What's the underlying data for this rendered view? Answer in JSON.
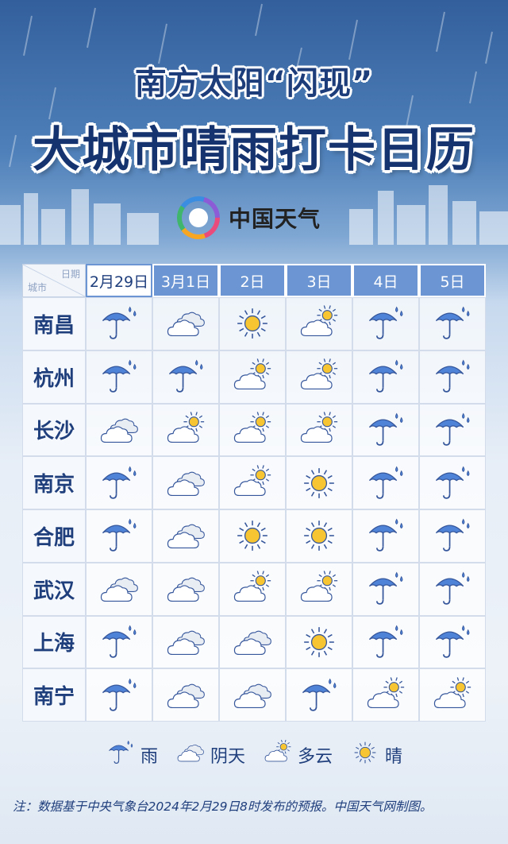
{
  "header": {
    "title_line1": "南方太阳“闪现”",
    "title_line2": "大城市晴雨打卡日历",
    "brand": "中国天气"
  },
  "table": {
    "corner_top": "日期",
    "corner_bottom": "城市",
    "dates": [
      "2月29日",
      "3月1日",
      "2日",
      "3日",
      "4日",
      "5日"
    ],
    "rows": [
      {
        "city": "南昌",
        "weather": [
          "rain",
          "overcast",
          "sunny",
          "cloudy",
          "rain",
          "rain"
        ]
      },
      {
        "city": "杭州",
        "weather": [
          "rain",
          "rain",
          "cloudy",
          "cloudy",
          "rain",
          "rain"
        ]
      },
      {
        "city": "长沙",
        "weather": [
          "overcast",
          "cloudy",
          "cloudy",
          "cloudy",
          "rain",
          "rain"
        ]
      },
      {
        "city": "南京",
        "weather": [
          "rain",
          "overcast",
          "cloudy",
          "sunny",
          "rain",
          "rain"
        ]
      },
      {
        "city": "合肥",
        "weather": [
          "rain",
          "overcast",
          "sunny",
          "sunny",
          "rain",
          "rain"
        ]
      },
      {
        "city": "武汉",
        "weather": [
          "overcast",
          "overcast",
          "cloudy",
          "cloudy",
          "rain",
          "rain"
        ]
      },
      {
        "city": "上海",
        "weather": [
          "rain",
          "overcast",
          "overcast",
          "sunny",
          "rain",
          "rain"
        ]
      },
      {
        "city": "南宁",
        "weather": [
          "rain",
          "overcast",
          "overcast",
          "rain",
          "cloudy",
          "cloudy"
        ]
      }
    ]
  },
  "legend": [
    {
      "icon": "rain",
      "label": "雨"
    },
    {
      "icon": "overcast",
      "label": "阴天"
    },
    {
      "icon": "cloudy",
      "label": "多云"
    },
    {
      "icon": "sunny",
      "label": "晴"
    }
  ],
  "footnote": "注：数据基于中央气象台2024年2月29日8时发布的预报。中国天气网制图。",
  "colors": {
    "header_bg": "#6b95d3",
    "title_text": "#15336e",
    "umbrella": "#4f83d8",
    "sun": "#f7c531"
  }
}
